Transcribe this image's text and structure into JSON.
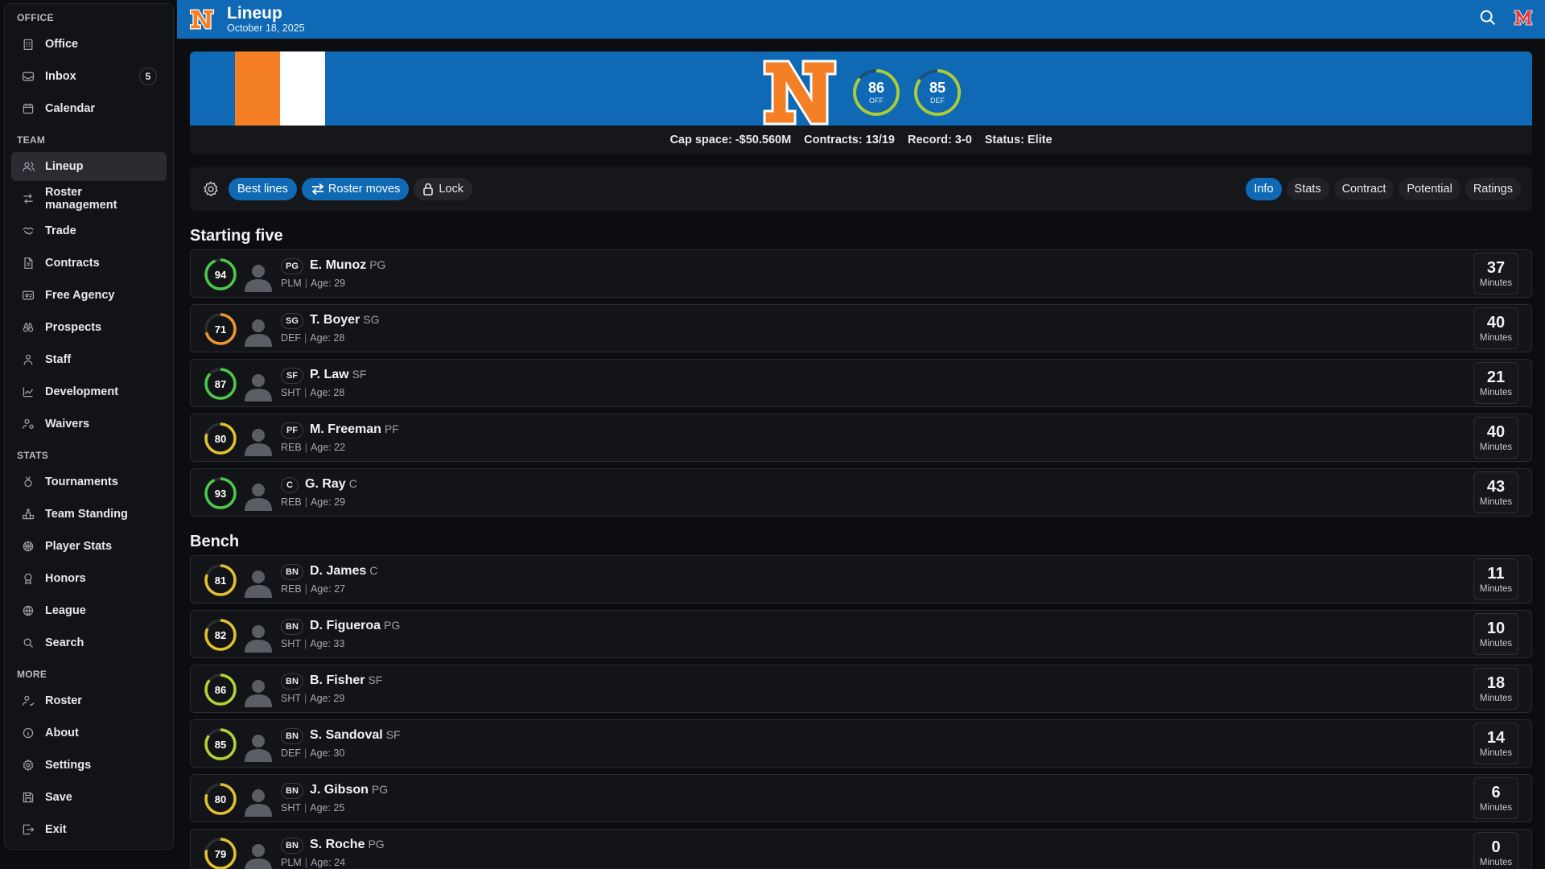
{
  "sidebar": {
    "sections": [
      {
        "title": "OFFICE",
        "items": [
          {
            "label": "Office",
            "icon": "office-icon"
          },
          {
            "label": "Inbox",
            "icon": "inbox-icon",
            "badge": "5"
          },
          {
            "label": "Calendar",
            "icon": "calendar-icon"
          }
        ]
      },
      {
        "title": "TEAM",
        "items": [
          {
            "label": "Lineup",
            "icon": "users-icon",
            "active": true
          },
          {
            "label": "Roster management",
            "icon": "swap-icon"
          },
          {
            "label": "Trade",
            "icon": "handshake-icon"
          },
          {
            "label": "Contracts",
            "icon": "document-icon"
          },
          {
            "label": "Free Agency",
            "icon": "id-card-icon"
          },
          {
            "label": "Prospects",
            "icon": "binoculars-icon"
          },
          {
            "label": "Staff",
            "icon": "person-icon"
          },
          {
            "label": "Development",
            "icon": "chart-line-icon"
          },
          {
            "label": "Waivers",
            "icon": "person-gear-icon"
          }
        ]
      },
      {
        "title": "STATS",
        "items": [
          {
            "label": "Tournaments",
            "icon": "medal-icon"
          },
          {
            "label": "Team Standing",
            "icon": "podium-icon"
          },
          {
            "label": "Player Stats",
            "icon": "basketball-icon"
          },
          {
            "label": "Honors",
            "icon": "award-icon"
          },
          {
            "label": "League",
            "icon": "globe-icon"
          },
          {
            "label": "Search",
            "icon": "search-icon"
          }
        ]
      },
      {
        "title": "MORE",
        "items": [
          {
            "label": "Roster",
            "icon": "roster-icon"
          },
          {
            "label": "About",
            "icon": "info-icon"
          },
          {
            "label": "Settings",
            "icon": "gear-icon"
          },
          {
            "label": "Save",
            "icon": "save-icon"
          },
          {
            "label": "Exit",
            "icon": "exit-icon"
          }
        ]
      }
    ]
  },
  "header": {
    "title": "Lineup",
    "date": "October 18, 2025",
    "accent": "#0f69b4"
  },
  "team": {
    "off_rating": "86",
    "off_label": "OFF",
    "def_rating": "85",
    "def_label": "DEF",
    "cap_space": "Cap space: -$50.560M",
    "contracts": "Contracts: 13/19",
    "record": "Record: 3-0",
    "status": "Status: Elite",
    "colors": {
      "primary": "#0f69b4",
      "secondary": "#f47f24",
      "tertiary": "#ffffff"
    }
  },
  "toolbar": {
    "best_lines": "Best lines",
    "roster_moves": "Roster moves",
    "lock": "Lock",
    "tabs": [
      "Info",
      "Stats",
      "Contract",
      "Potential",
      "Ratings"
    ],
    "active_tab": "Info"
  },
  "starting_title": "Starting five",
  "bench_title": "Bench",
  "minutes_label": "Minutes",
  "starters": [
    {
      "ovr": "94",
      "slot": "PG",
      "name": "E. Munoz",
      "pos": "PG",
      "role": "PLM",
      "age": "Age: 29",
      "minutes": "37"
    },
    {
      "ovr": "71",
      "slot": "SG",
      "name": "T. Boyer",
      "pos": "SG",
      "role": "DEF",
      "age": "Age: 28",
      "minutes": "40"
    },
    {
      "ovr": "87",
      "slot": "SF",
      "name": "P. Law",
      "pos": "SF",
      "role": "SHT",
      "age": "Age: 28",
      "minutes": "21"
    },
    {
      "ovr": "80",
      "slot": "PF",
      "name": "M. Freeman",
      "pos": "PF",
      "role": "REB",
      "age": "Age: 22",
      "minutes": "40"
    },
    {
      "ovr": "93",
      "slot": "C",
      "name": "G. Ray",
      "pos": "C",
      "role": "REB",
      "age": "Age: 29",
      "minutes": "43"
    }
  ],
  "bench": [
    {
      "ovr": "81",
      "slot": "BN",
      "name": "D. James",
      "pos": "C",
      "role": "REB",
      "age": "Age: 27",
      "minutes": "11"
    },
    {
      "ovr": "82",
      "slot": "BN",
      "name": "D. Figueroa",
      "pos": "PG",
      "role": "SHT",
      "age": "Age: 33",
      "minutes": "10"
    },
    {
      "ovr": "86",
      "slot": "BN",
      "name": "B. Fisher",
      "pos": "SF",
      "role": "SHT",
      "age": "Age: 29",
      "minutes": "18"
    },
    {
      "ovr": "85",
      "slot": "BN",
      "name": "S. Sandoval",
      "pos": "SF",
      "role": "DEF",
      "age": "Age: 30",
      "minutes": "14"
    },
    {
      "ovr": "80",
      "slot": "BN",
      "name": "J. Gibson",
      "pos": "PG",
      "role": "SHT",
      "age": "Age: 25",
      "minutes": "6"
    },
    {
      "ovr": "79",
      "slot": "BN",
      "name": "S. Roche",
      "pos": "PG",
      "role": "PLM",
      "age": "Age: 24",
      "minutes": "0"
    }
  ]
}
